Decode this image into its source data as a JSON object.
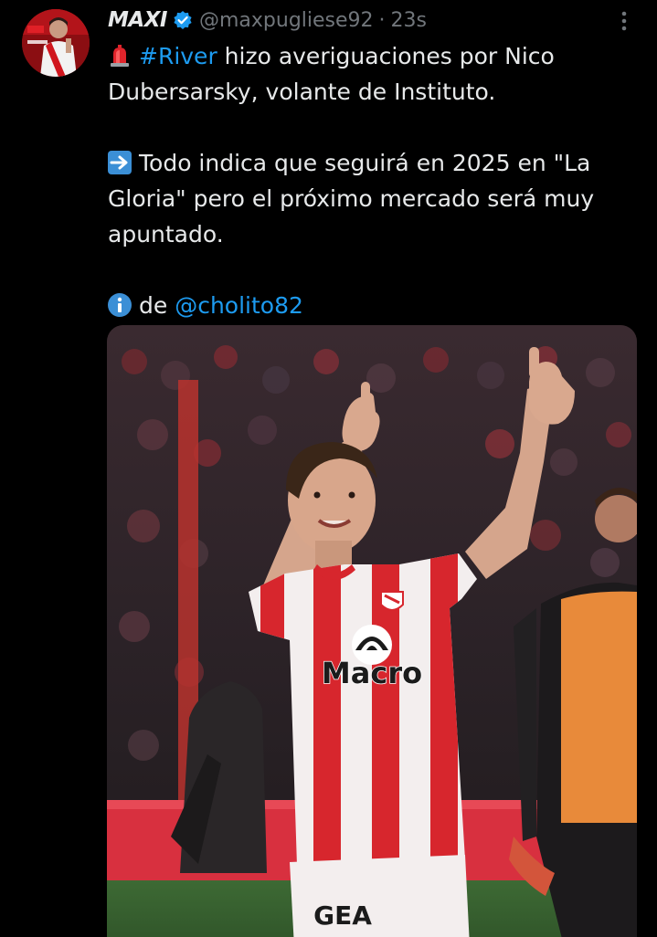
{
  "tweet": {
    "display_name": "MAXI",
    "handle": "@maxpugliese92",
    "separator": "·",
    "time": "23s",
    "para1": {
      "hashtag": "#River",
      "text": " hizo averiguaciones por Nico Dubersarsky, volante de Instituto."
    },
    "para2": {
      "text": "Todo indica que seguirá en 2025 en \"La Gloria\" pero el próximo mercado será muy apuntado."
    },
    "para3": {
      "prefix": "de ",
      "mention": "@cholito82"
    },
    "media": {
      "sponsor_main": "Macro",
      "sponsor_shorts": "GEA"
    }
  },
  "icons": {
    "siren": "police-car-light-icon",
    "arrow": "right-arrow-icon",
    "info": "information-icon",
    "verified": "verified-badge-icon",
    "more": "more-options-icon"
  },
  "colors": {
    "background": "#000000",
    "text": "#e7e9ea",
    "secondary": "#71767b",
    "link": "#1d9bf0"
  }
}
